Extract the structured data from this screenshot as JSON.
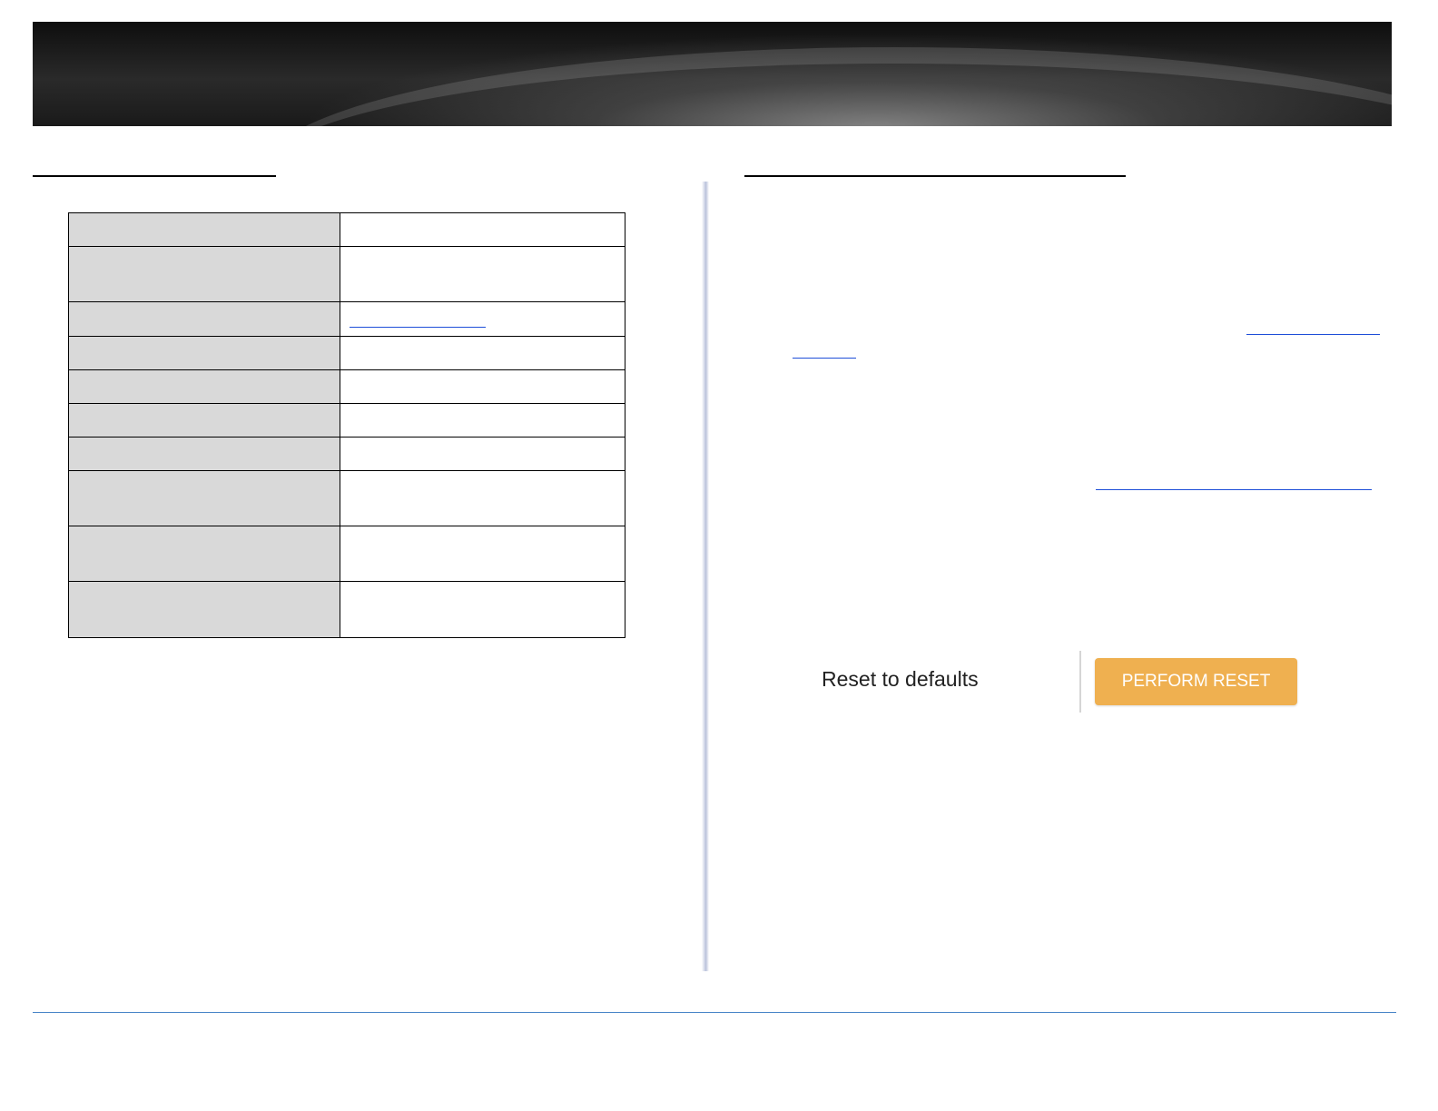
{
  "reset_panel": {
    "label": "Reset to defaults",
    "button_label": "PERFORM RESET"
  },
  "colors": {
    "button": "#efb050",
    "link": "#1e4ed8",
    "footer_rule": "#4a86c8",
    "table_key_cell": "#d9d9d9"
  }
}
